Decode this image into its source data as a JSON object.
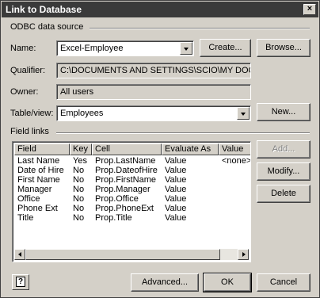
{
  "window": {
    "title": "Link to Database",
    "close_glyph": "×"
  },
  "odbc": {
    "group_label": "ODBC data source",
    "name_label": "Name:",
    "name_value": "Excel-Employee",
    "create_button": "Create...",
    "browse_button": "Browse...",
    "qualifier_label": "Qualifier:",
    "qualifier_value": "C:\\DOCUMENTS AND SETTINGS\\SCIO\\MY DOCUMENT",
    "owner_label": "Owner:",
    "owner_value": "All users",
    "table_label": "Table/view:",
    "table_value": "Employees",
    "new_button": "New..."
  },
  "fields": {
    "group_label": "Field links",
    "columns": [
      "Field",
      "Key",
      "Cell",
      "Evaluate As",
      "Value"
    ],
    "rows": [
      [
        "Last Name",
        "Yes",
        "Prop.LastName",
        "Value",
        "<none>"
      ],
      [
        "Date of Hire",
        "No",
        "Prop.DateofHire",
        "Value",
        ""
      ],
      [
        "First Name",
        "No",
        "Prop.FirstName",
        "Value",
        ""
      ],
      [
        "Manager",
        "No",
        "Prop.Manager",
        "Value",
        ""
      ],
      [
        "Office",
        "No",
        "Prop.Office",
        "Value",
        ""
      ],
      [
        "Phone Ext",
        "No",
        "Prop.PhoneExt",
        "Value",
        ""
      ],
      [
        "Title",
        "No",
        "Prop.Title",
        "Value",
        ""
      ]
    ],
    "add_button": "Add...",
    "modify_button": "Modify...",
    "delete_button": "Delete"
  },
  "footer": {
    "help_glyph": "?",
    "advanced_button": "Advanced...",
    "ok_button": "OK",
    "cancel_button": "Cancel"
  }
}
